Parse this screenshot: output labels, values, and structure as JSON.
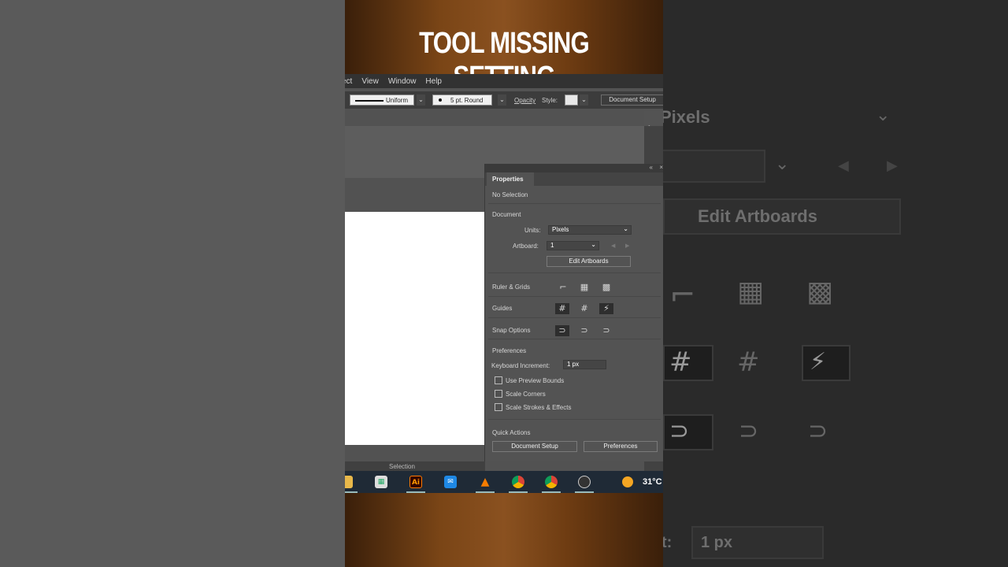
{
  "banner": {
    "title": "TOOL MISSING SETTING"
  },
  "menubar": {
    "items": [
      "ect",
      "View",
      "Window",
      "Help"
    ]
  },
  "controlbar": {
    "stroke_profile": "Uniform",
    "brush": "5 pt. Round",
    "opacity_label": "Opacity",
    "style_label": "Style:",
    "document_setup": "Document Setup"
  },
  "status": {
    "tool": "Selection"
  },
  "properties": {
    "tab": "Properties",
    "selection": "No Selection",
    "document_heading": "Document",
    "units_label": "Units:",
    "units_value": "Pixels",
    "artboard_label": "Artboard:",
    "artboard_value": "1",
    "edit_artboards": "Edit Artboards",
    "ruler_grids": "Ruler & Grids",
    "guides": "Guides",
    "snap_options": "Snap Options",
    "preferences_heading": "Preferences",
    "keyboard_increment_label": "Keyboard Increment:",
    "keyboard_increment_value": "1 px",
    "use_preview_bounds": "Use Preview Bounds",
    "scale_corners": "Scale Corners",
    "scale_strokes": "Scale Strokes & Effects",
    "quick_actions": "Quick Actions",
    "qa_document_setup": "Document Setup",
    "qa_preferences": "Preferences"
  },
  "taskbar": {
    "ai_label": "Ai",
    "weather": "31°C"
  },
  "zoom": {
    "units_value": "Pixels",
    "edit_artboards": "Edit Artboards",
    "increment_label": "t:",
    "increment_value": "1 px"
  },
  "colors": {
    "accent_brand": "#ff7c00",
    "panel": "#535353",
    "banner": "#7a4516"
  }
}
